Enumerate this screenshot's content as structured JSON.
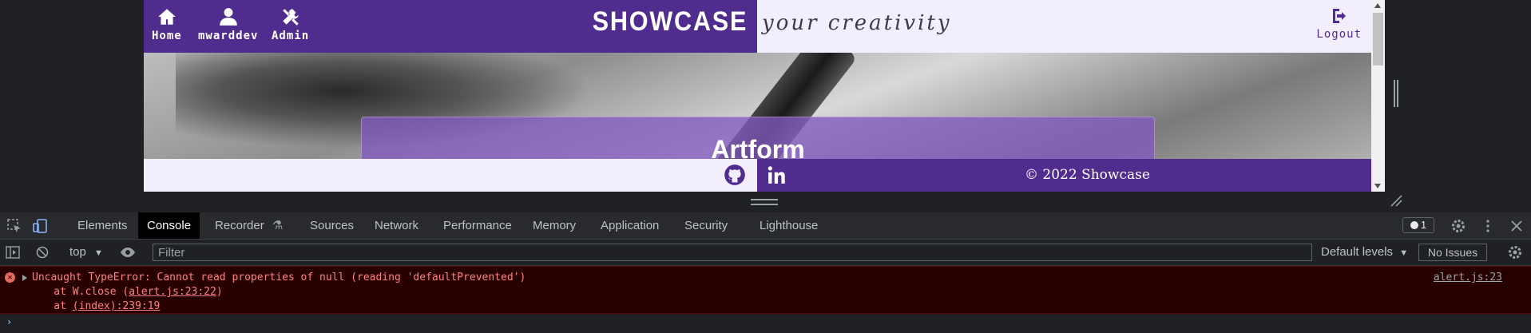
{
  "site": {
    "nav": [
      {
        "label": "Home",
        "icon": "home-icon"
      },
      {
        "label": "mwarddev",
        "icon": "user-icon"
      },
      {
        "label": "Admin",
        "icon": "tools-icon"
      }
    ],
    "brand": "SHOWCASE",
    "tagline": "your creativity",
    "logout_label": "Logout",
    "hero_title": "Artform",
    "footer_copyright": "© 2022 Showcase",
    "colors": {
      "primary": "#512c8f",
      "light": "#f3eefb"
    }
  },
  "devtools": {
    "tabs": [
      "Elements",
      "Console",
      "Recorder",
      "Sources",
      "Network",
      "Performance",
      "Memory",
      "Application",
      "Security",
      "Lighthouse"
    ],
    "active_tab": "Console",
    "issues_count": "1",
    "context": "top",
    "filter_placeholder": "Filter",
    "levels": "Default levels",
    "issues_button": "No Issues",
    "error": {
      "message": "Uncaught TypeError: Cannot read properties of null (reading 'defaultPrevented')",
      "frame1_prefix": "    at W.close (",
      "frame1_link": "alert.js:23:22",
      "frame1_suffix": ")",
      "frame2_prefix": "    at ",
      "frame2_link": "(index):239:19",
      "source": "alert.js:23"
    },
    "prompt": "›"
  }
}
